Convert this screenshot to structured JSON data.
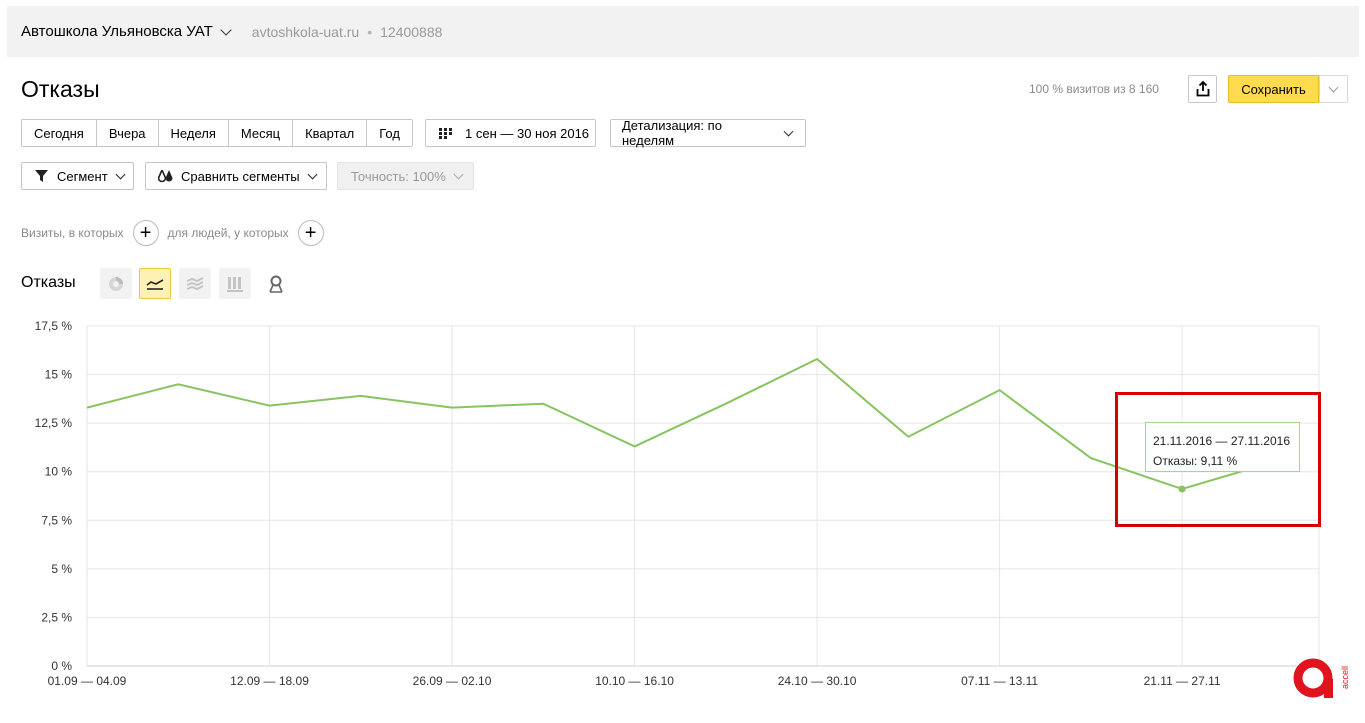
{
  "header": {
    "site_name": "Автошкола Ульяновска УАТ",
    "domain": "avtoshkola-uat.ru",
    "separator": "•",
    "counter_id": "12400888"
  },
  "page": {
    "title": "Отказы",
    "visits_info": "100 % визитов из 8 160",
    "save_label": "Сохранить"
  },
  "periods": [
    "Сегодня",
    "Вчера",
    "Неделя",
    "Месяц",
    "Квартал",
    "Год"
  ],
  "date_range": "1 сен — 30 ноя 2016",
  "detail": "Детализация: по неделям",
  "segment": "Сегмент",
  "compare": "Сравнить сегменты",
  "accuracy": "Точность: 100%",
  "conditions": {
    "visits_label": "Визиты, в которых",
    "people_label": "для людей, у которых"
  },
  "chart_title": "Отказы",
  "chart_types": [
    "pie-chart-icon",
    "line-chart-icon",
    "area-chart-icon",
    "bar-chart-icon",
    "map-icon"
  ],
  "tooltip": {
    "range": "21.11.2016 — 27.11.2016",
    "value": "Отказы: 9,11 %"
  },
  "logo_text": "accell",
  "colors": {
    "line": "#87c45f",
    "save": "#ffdb4d",
    "highlight": "#d70000"
  },
  "chart_data": {
    "type": "line",
    "series": [
      {
        "values": [
          13.3,
          14.5,
          13.4,
          13.9,
          13.3,
          13.5,
          11.3,
          13.5,
          15.8,
          11.8,
          14.2,
          10.7,
          9.11,
          10.5
        ]
      }
    ],
    "x_ticks": [
      "01.09 — 04.09",
      "12.09 — 18.09",
      "26.09 — 02.10",
      "10.10 — 16.10",
      "24.10 — 30.10",
      "07.11 — 13.11",
      "21.11 — 27.11"
    ],
    "y_ticks": [
      "0 %",
      "2,5 %",
      "5 %",
      "7,5 %",
      "10 %",
      "12,5 %",
      "15 %",
      "17,5 %"
    ],
    "ylim": [
      0,
      17.5
    ],
    "grid": true,
    "highlighted_index": 12
  }
}
